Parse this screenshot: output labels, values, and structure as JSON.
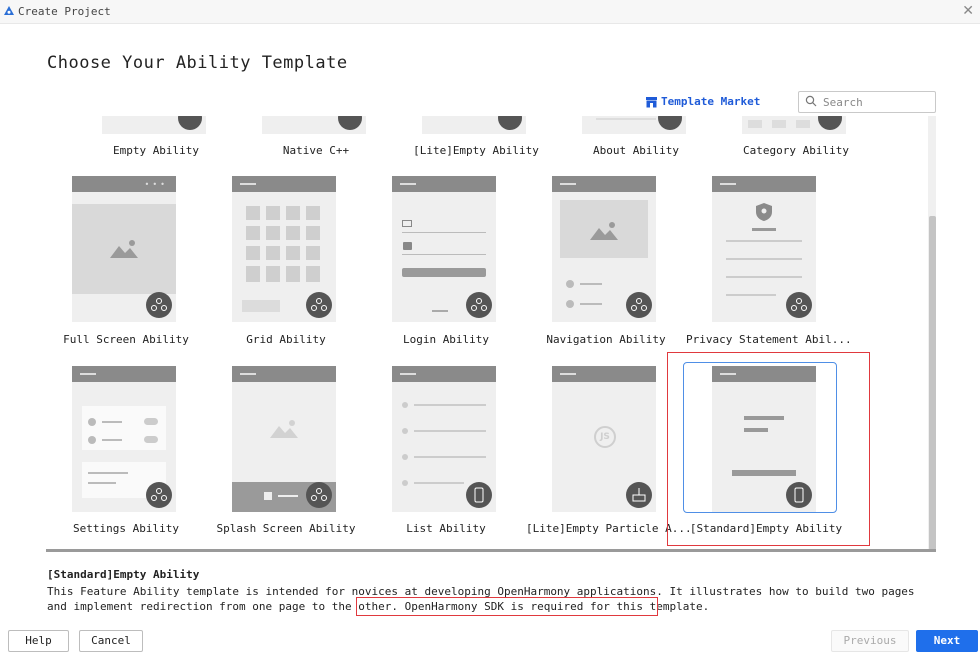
{
  "window": {
    "title": "Create Project",
    "logo_icon": "harmony-logo-icon",
    "close_icon": "close-icon"
  },
  "heading": "Choose Your Ability Template",
  "toolbar": {
    "market_label": "Template Market",
    "market_icon": "store-icon",
    "search_placeholder": "Search",
    "search_icon": "search-icon"
  },
  "templates": [
    {
      "label": "Empty Ability"
    },
    {
      "label": "Native C++"
    },
    {
      "label": "[Lite]Empty Ability"
    },
    {
      "label": "About Ability"
    },
    {
      "label": "Category Ability"
    },
    {
      "label": "Full Screen Ability"
    },
    {
      "label": "Grid Ability"
    },
    {
      "label": "Login Ability"
    },
    {
      "label": "Navigation Ability"
    },
    {
      "label": "Privacy Statement Abil..."
    },
    {
      "label": "Settings Ability"
    },
    {
      "label": "Splash Screen Ability"
    },
    {
      "label": "List Ability"
    },
    {
      "label": "[Lite]Empty Particle A..."
    },
    {
      "label": "[Standard]Empty Ability",
      "selected": true
    }
  ],
  "description": {
    "title": "[Standard]Empty Ability",
    "text": "This Feature Ability template is intended for novices at developing OpenHarmony applications. It illustrates how to build two pages and implement redirection from one page to the other. OpenHarmony SDK is required for this template."
  },
  "buttons": {
    "help": "Help",
    "cancel": "Cancel",
    "previous": "Previous",
    "next": "Next"
  },
  "colors": {
    "accent": "#1f6feb",
    "highlight": "#e0393e",
    "thumbnail": "#efefef",
    "header": "#8a8a8a"
  }
}
